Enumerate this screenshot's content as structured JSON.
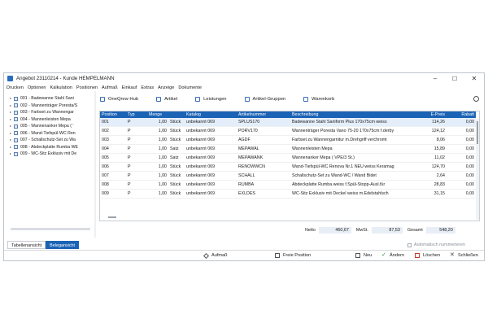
{
  "window": {
    "title": "Angebot 23110214 - Kunde HEMPELMANN",
    "controls": [
      "–",
      "☐",
      "✕"
    ]
  },
  "menu": [
    "Drucken",
    "Optionen",
    "Kalkulation",
    "Positionen",
    "Aufmaß",
    "Einkauf",
    "Extras",
    "Anzeige",
    "Dokumente"
  ],
  "tree": {
    "items": [
      "001 - Badewanne Stahl Sani",
      "002 - Wannenträger Poresta/S",
      "003 - Farbset zu Wannengar",
      "004 - Wannenleisten Mepa",
      "005 - Wannenanker Mepa ( '",
      "006 - Wand-Tiefspül-WC Ren",
      "007 - Schallschutz-Set zu Wa",
      "008 - Abdeckplatte Rumba WE",
      "009 - WC-Sitz Exklusiv mit De"
    ]
  },
  "toolbar": {
    "items": [
      {
        "label": "OneQrew Hub",
        "icon": "hub-icon"
      },
      {
        "label": "Artikel",
        "icon": "article-icon"
      },
      {
        "label": "Leistungen",
        "icon": "services-icon"
      },
      {
        "label": "Artikel-Gruppen",
        "icon": "folder-icon"
      },
      {
        "label": "Warenkorb",
        "icon": "cart-icon"
      }
    ],
    "search_icon": "search-icon"
  },
  "grid": {
    "columns": [
      "Position",
      "Typ",
      "Menge",
      "",
      "Katalog",
      "Artikelnummer",
      "Beschreibung",
      "E-Preis",
      "Rabatt"
    ],
    "rows": [
      [
        "001",
        "P",
        "1,00",
        "Stück",
        "unbekannt 069",
        "SPLUS170",
        "Badewanne Stahl Saniform Plus 170x75cm weiss",
        "114,26",
        "0,00"
      ],
      [
        "002",
        "P",
        "1,00",
        "Stück",
        "unbekannt 069",
        "PORV170",
        "Wannenträger Poresta Vano 75-20 170x75cm f.derby",
        "124,12",
        "0,00"
      ],
      [
        "003",
        "P",
        "1,00",
        "Stück",
        "unbekannt 069",
        "AGDF",
        "Farbset zu Wannengarnitur m.Drehgriff verchromt",
        "8,06",
        "0,00"
      ],
      [
        "004",
        "P",
        "1,00",
        "Satz",
        "unbekannt 069",
        "MEPAWAL",
        "Wannenleisten Mepa",
        "15,89",
        "0,00"
      ],
      [
        "005",
        "P",
        "1,00",
        "Satz",
        "unbekannt 069",
        "MEPAWANK",
        "Wannenanker Mepa ( VPE/3 St.)",
        "11,02",
        "0,00"
      ],
      [
        "006",
        "P",
        "1,00",
        "Stück",
        "unbekannt 069",
        "RENOWWCN",
        "Wand-Tiefspül-WC Renova Nr.1 NEU weiss Keramag",
        "124,70",
        "0,00"
      ],
      [
        "007",
        "P",
        "1,00",
        "Stück",
        "unbekannt 069",
        "SCHALL",
        "Schallschutz-Set zu Wand-WC / Wand Bidet",
        "2,64",
        "0,00"
      ],
      [
        "008",
        "P",
        "1,00",
        "Stück",
        "unbekannt 069",
        "RUMBA",
        "Abdeckplatte Rumba weiss f.Spül-Stopp-Ausl.für",
        "28,83",
        "0,00"
      ],
      [
        "009",
        "P",
        "1,00",
        "Stück",
        "unbekannt 069",
        "EXLDES",
        "WC-Sitz Exklusiv mit Deckel weiss m.Edelstahlsch",
        "31,15",
        "0,00"
      ]
    ]
  },
  "totals": {
    "netto_label": "Netto",
    "netto_value": "460,67",
    "mwst_label": "MwSt.",
    "mwst_value": "87,53",
    "gesamt_label": "Gesamt",
    "gesamt_value": "548,20"
  },
  "tabs": [
    "Tabellenansicht",
    "Belegansicht"
  ],
  "auto_number_label": "Automatisch nummerieren",
  "bottom": {
    "aufmass": "Aufmaß",
    "freie_position": "Freie Position",
    "neu": "Neu",
    "aendern": "Ändern",
    "loeschen": "Löschen",
    "schliessen": "Schließen"
  },
  "colors": {
    "accent": "#1b63b5",
    "selected_row": "#e4eefa"
  }
}
